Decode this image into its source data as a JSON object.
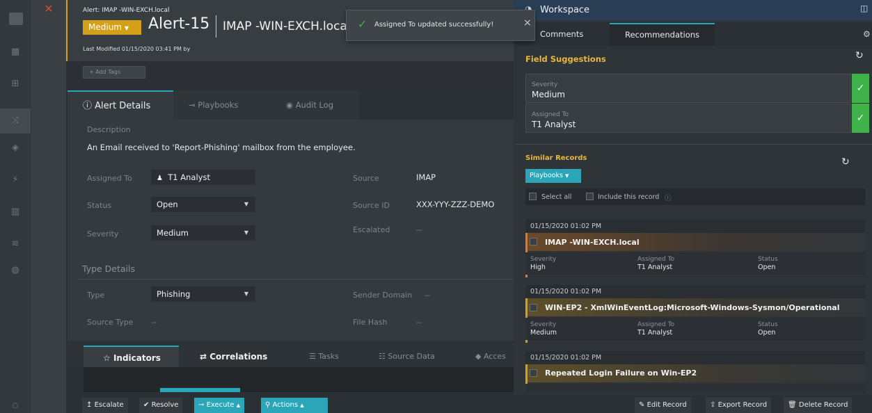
{
  "header": {
    "breadcrumb": "Alert: IMAP -WIN-EXCH.local",
    "severity_badge": "Medium",
    "alert_number": "Alert-15",
    "alert_name": "IMAP -WIN-EXCH.local",
    "last_modified": "Last Modified 01/15/2020 03:41 PM by",
    "add_tags": "+ Add Tags"
  },
  "toast": {
    "message": "Assigned To updated successfully!",
    "close": "×"
  },
  "tabs": {
    "details": "Alert Details",
    "playbooks": "Playbooks",
    "audit": "Audit Log"
  },
  "details": {
    "description_label": "Description",
    "description": "An Email received to 'Report-Phishing' mailbox from the employee.",
    "assigned_to_label": "Assigned To",
    "assigned_to": "T1 Analyst",
    "status_label": "Status",
    "status": "Open",
    "severity_label": "Severity",
    "severity": "Medium",
    "source_label": "Source",
    "source": "IMAP",
    "source_id_label": "Source ID",
    "source_id": "XXX-YYY-ZZZ-DEMO",
    "escalated_label": "Escalated",
    "escalated": "--",
    "type_details_label": "Type Details",
    "type_label": "Type",
    "type": "Phishing",
    "sender_domain_label": "Sender Domain",
    "sender_domain": "--",
    "source_type_label": "Source Type",
    "source_type": "--",
    "file_hash_label": "File Hash",
    "file_hash": "--"
  },
  "lower_tabs": {
    "indicators": "Indicators",
    "correlations": "Correlations",
    "tasks": "Tasks",
    "source_data": "Source Data",
    "access": "Acces"
  },
  "bottom": {
    "escalate": "Escalate",
    "resolve": "Resolve",
    "execute": "Execute",
    "actions": "Actions",
    "edit": "Edit Record",
    "export": "Export Record",
    "delete": "Delete Record"
  },
  "workspace": {
    "title": "Workspace",
    "tab_comments": "Comments",
    "tab_recommendations": "Recommendations",
    "field_suggestions": "Field Suggestions",
    "suggestions": [
      {
        "label": "Severity",
        "value": "Medium"
      },
      {
        "label": "Assigned To",
        "value": "T1 Analyst"
      }
    ],
    "similar_records": "Similar Records",
    "playbooks_btn": "Playbooks",
    "select_all": "Select all",
    "include_record": "Include this record",
    "records": [
      {
        "date": "01/15/2020 01:02 PM",
        "title": "IMAP -WIN-EXCH.local",
        "severity": "High",
        "assigned": "T1 Analyst",
        "status": "Open",
        "color": "#e07a2a"
      },
      {
        "date": "01/15/2020 01:02 PM",
        "title": "WIN-EP2 - XmlWinEventLog:Microsoft-Windows-Sysmon/Operational",
        "severity": "Medium",
        "assigned": "T1 Analyst",
        "status": "Open",
        "color": "#d4a017"
      },
      {
        "date": "01/15/2020 01:02 PM",
        "title": "Repeated Login Failure on Win-EP2",
        "severity": "",
        "assigned": "",
        "status": "",
        "color": "#d4a017"
      }
    ],
    "meta_labels": {
      "severity": "Severity",
      "assigned": "Assigned To",
      "status": "Status"
    }
  },
  "colors": {
    "accent": "#2aa6b8",
    "medium": "#d4a017",
    "high": "#e07a2a",
    "success": "#3fb24a"
  }
}
